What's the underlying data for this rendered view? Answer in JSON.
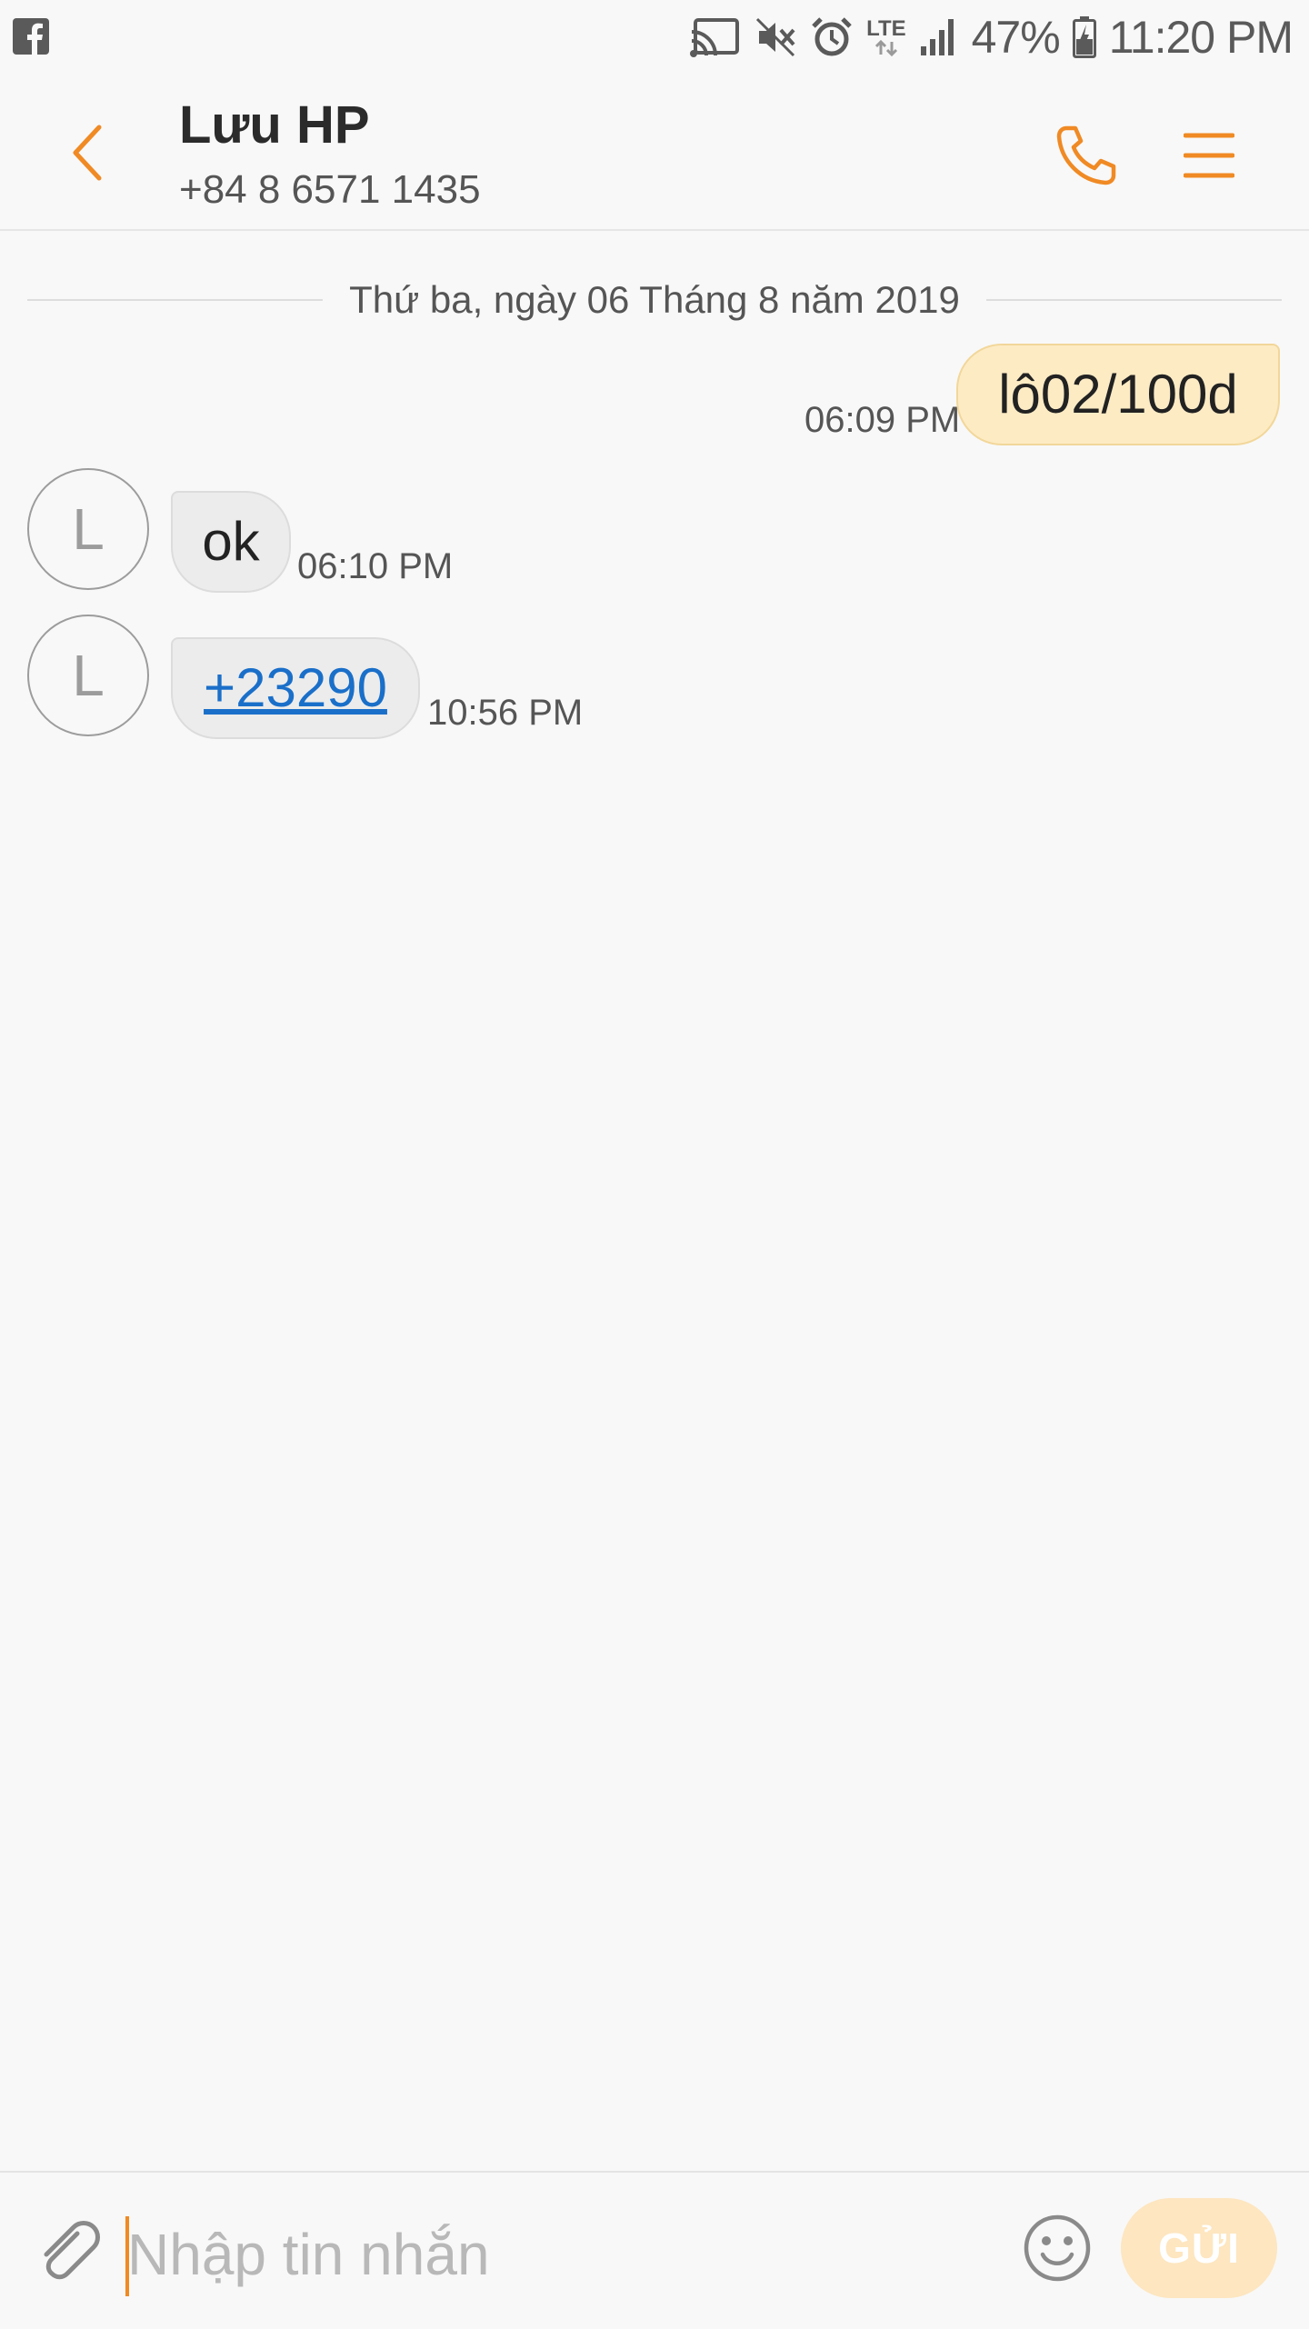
{
  "status_bar": {
    "left_icon": "facebook-icon",
    "icons": [
      "cast-icon",
      "mute-icon",
      "alarm-icon",
      "lte-icon",
      "signal-icon",
      "battery-icon"
    ],
    "network_label": "LTE",
    "battery_percent": "47%",
    "time": "11:20 PM"
  },
  "header": {
    "back_icon": "chevron-left-icon",
    "contact_name": "Lưu HP",
    "contact_number": "+84 8 6571 1435",
    "call_icon": "phone-icon",
    "menu_icon": "menu-icon"
  },
  "conversation": {
    "date_label": "Thứ ba, ngày 06 Tháng 8 năm 2019",
    "messages": [
      {
        "direction": "outgoing",
        "text": "lô02/100d",
        "time": "06:09 PM"
      },
      {
        "direction": "incoming",
        "avatar_letter": "L",
        "text": "ok",
        "time": "06:10 PM"
      },
      {
        "direction": "incoming",
        "avatar_letter": "L",
        "text": "+23290",
        "time": "10:56 PM",
        "is_link": true
      }
    ]
  },
  "composer": {
    "attach_icon": "paperclip-icon",
    "placeholder": "Nhập tin nhắn",
    "value": "",
    "emoji_icon": "emoji-icon",
    "send_label": "GỬI"
  },
  "colors": {
    "accent": "#f08a24",
    "outgoing_bubble": "#fdebc4",
    "incoming_bubble": "#ececec",
    "link": "#1a6fc9",
    "send_button": "#fde6c0"
  }
}
